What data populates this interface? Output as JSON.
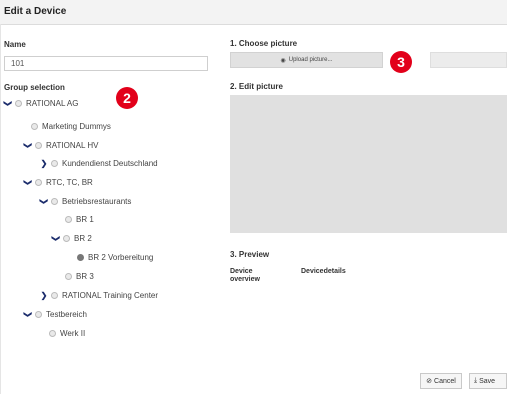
{
  "dialog": {
    "title": "Edit a Device"
  },
  "name_field": {
    "label": "Name",
    "value": "101"
  },
  "group": {
    "label": "Group selection",
    "tree": [
      {
        "label": "RATIONAL AG",
        "expanded": true,
        "selected": false
      },
      {
        "label": "Marketing Dummys",
        "expanded": null,
        "selected": false
      },
      {
        "label": "RATIONAL HV",
        "expanded": true,
        "selected": false
      },
      {
        "label": "Kundendienst Deutschland",
        "expanded": false,
        "selected": false
      },
      {
        "label": "RTC, TC, BR",
        "expanded": true,
        "selected": false
      },
      {
        "label": "Betriebsrestaurants",
        "expanded": true,
        "selected": false
      },
      {
        "label": "BR 1",
        "expanded": null,
        "selected": false
      },
      {
        "label": "BR 2",
        "expanded": true,
        "selected": false
      },
      {
        "label": "BR 2 Vorbereitung",
        "expanded": null,
        "selected": true
      },
      {
        "label": "BR 3",
        "expanded": null,
        "selected": false
      },
      {
        "label": "RATIONAL Training Center",
        "expanded": false,
        "selected": false
      },
      {
        "label": "Testbereich",
        "expanded": true,
        "selected": false
      },
      {
        "label": "Werk II",
        "expanded": null,
        "selected": false
      }
    ]
  },
  "picture": {
    "choose_label": "1. Choose picture",
    "upload_button": "Upload picture...",
    "edit_label": "2. Edit picture"
  },
  "preview": {
    "label": "3. Preview",
    "device_overview": "Device overview",
    "device_details": "Devicedetails"
  },
  "footer": {
    "cancel": "Cancel",
    "save": "Save"
  },
  "badges": {
    "badge_2": "2",
    "badge_3": "3"
  },
  "colors": {
    "badge": "#e2001a",
    "chevron": "#1a2b6b"
  }
}
